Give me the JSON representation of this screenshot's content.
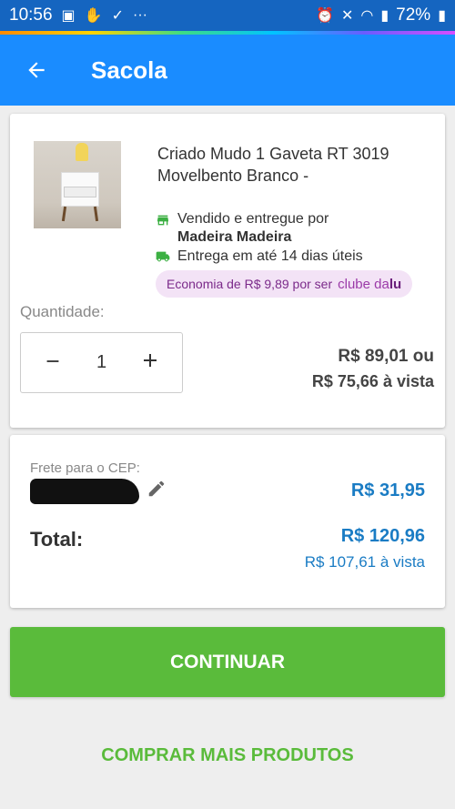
{
  "status_bar": {
    "time": "10:56",
    "battery": "72%",
    "left_icons": [
      "image-icon",
      "hand-icon",
      "download-icon",
      "more-icon"
    ],
    "right_icons": [
      "alarm-icon",
      "mute-icon",
      "wifi-icon",
      "signal-icon",
      "battery-icon"
    ]
  },
  "app_bar": {
    "title": "Sacola",
    "color": "#1a8cff"
  },
  "product": {
    "name": "Criado Mudo 1 Gaveta RT 3019 Movelbento Branco -",
    "seller_prefix": "Vendido e entregue por",
    "seller_name": "Madeira Madeira",
    "delivery": "Entrega em até 14 dias úteis",
    "clube_text": "Economia de R$ 9,89 por ser",
    "clube_logo_prefix": "clube da",
    "clube_logo_suffix": "lu",
    "quantity_label": "Quantidade:",
    "quantity": "1",
    "price": "R$ 89,01 ou",
    "price_cash": "R$ 75,66 à vista"
  },
  "shipping": {
    "cep_label": "Frete para o CEP:",
    "value": "R$ 31,95"
  },
  "total": {
    "label": "Total:",
    "value": "R$ 120,96",
    "cash": "R$ 107,61 à vista"
  },
  "buttons": {
    "continue": "CONTINUAR",
    "more": "COMPRAR MAIS PRODUTOS"
  },
  "colors": {
    "primary": "#1a8cff",
    "green": "#5abb3b",
    "price_blue": "#1a7cc4"
  }
}
